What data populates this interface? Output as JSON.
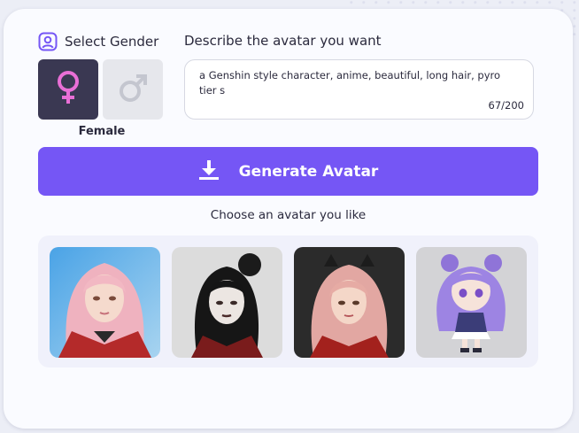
{
  "gender": {
    "title": "Select Gender",
    "selected_label": "Female",
    "options": [
      {
        "id": "female",
        "icon": "female-symbol-icon",
        "selected": true
      },
      {
        "id": "male",
        "icon": "male-symbol-icon",
        "selected": false
      }
    ]
  },
  "description": {
    "title": "Describe the avatar you want",
    "value": "a Genshin style character, anime, beautiful, long hair, pyro tier s",
    "count": "67/200"
  },
  "generate": {
    "label": "Generate Avatar",
    "icon": "download-icon"
  },
  "gallery": {
    "prompt": "Choose an avatar you like",
    "avatars": [
      {
        "name": "watercolor-pink-hair-girl"
      },
      {
        "name": "black-hair-gothic-girl"
      },
      {
        "name": "pink-hair-red-outfit-girl"
      },
      {
        "name": "chibi-purple-hair-girl"
      }
    ]
  },
  "colors": {
    "accent": "#7556f5",
    "selected_gender_bg": "#3a3852",
    "female_symbol": "#e96fd6",
    "male_symbol": "#c4c6cf"
  }
}
